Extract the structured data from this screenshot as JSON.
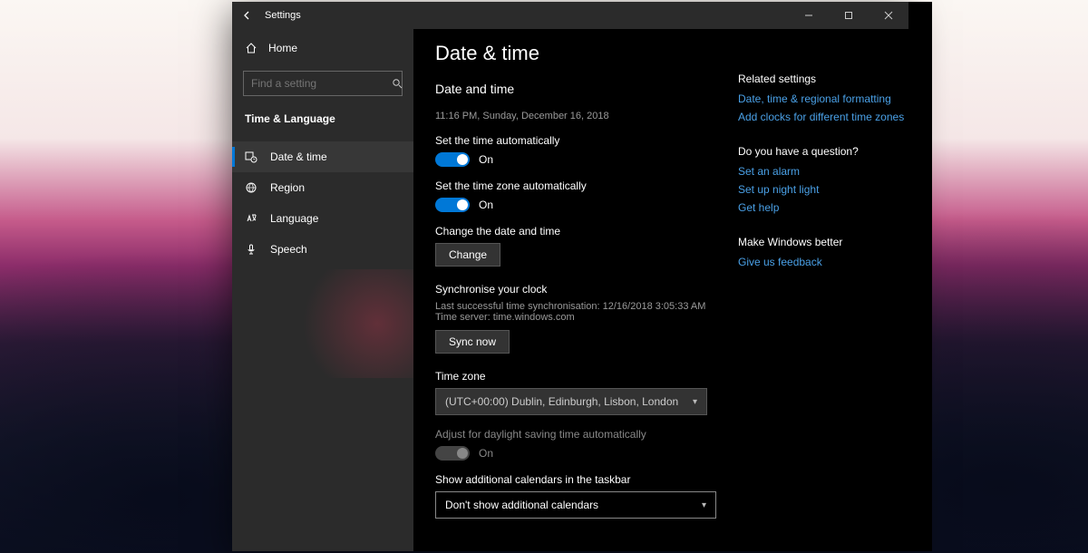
{
  "window": {
    "title": "Settings"
  },
  "sidebar": {
    "home": "Home",
    "search_placeholder": "Find a setting",
    "section": "Time & Language",
    "items": [
      {
        "label": "Date & time"
      },
      {
        "label": "Region"
      },
      {
        "label": "Language"
      },
      {
        "label": "Speech"
      }
    ]
  },
  "main": {
    "page_title": "Date & time",
    "section1_title": "Date and time",
    "current_datetime": "11:16 PM, Sunday, December 16, 2018",
    "auto_time_label": "Set the time automatically",
    "auto_time_state": "On",
    "auto_tz_label": "Set the time zone automatically",
    "auto_tz_state": "On",
    "change_dt_label": "Change the date and time",
    "change_btn": "Change",
    "sync_title": "Synchronise your clock",
    "sync_last": "Last successful time synchronisation: 12/16/2018 3:05:33 AM",
    "sync_server": "Time server:  time.windows.com",
    "sync_btn": "Sync now",
    "tz_label": "Time zone",
    "tz_value": "(UTC+00:00) Dublin, Edinburgh, Lisbon, London",
    "dst_label": "Adjust for daylight saving time automatically",
    "dst_state": "On",
    "addcal_label": "Show additional calendars in the taskbar",
    "addcal_value": "Don't show additional calendars"
  },
  "side": {
    "related_hdr": "Related settings",
    "related_links": [
      "Date, time & regional formatting",
      "Add clocks for different time zones"
    ],
    "question_hdr": "Do you have a question?",
    "question_links": [
      "Set an alarm",
      "Set up night light",
      "Get help"
    ],
    "feedback_hdr": "Make Windows better",
    "feedback_links": [
      "Give us feedback"
    ]
  }
}
